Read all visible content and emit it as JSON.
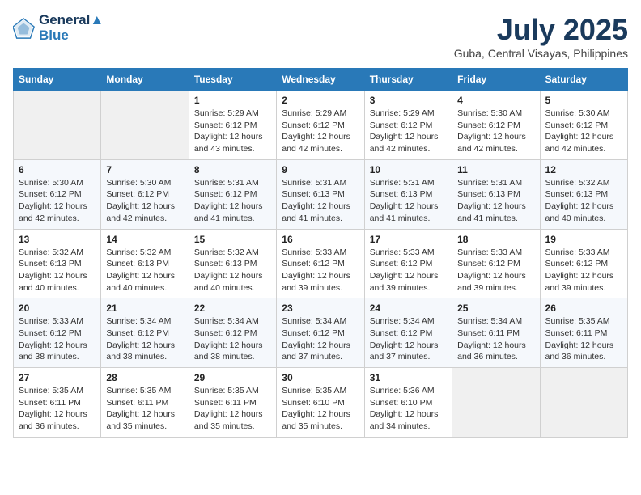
{
  "header": {
    "logo_line1": "General",
    "logo_line2": "Blue",
    "title": "July 2025",
    "subtitle": "Guba, Central Visayas, Philippines"
  },
  "calendar": {
    "days_of_week": [
      "Sunday",
      "Monday",
      "Tuesday",
      "Wednesday",
      "Thursday",
      "Friday",
      "Saturday"
    ],
    "weeks": [
      [
        {
          "num": "",
          "info": ""
        },
        {
          "num": "",
          "info": ""
        },
        {
          "num": "1",
          "info": "Sunrise: 5:29 AM\nSunset: 6:12 PM\nDaylight: 12 hours and 43 minutes."
        },
        {
          "num": "2",
          "info": "Sunrise: 5:29 AM\nSunset: 6:12 PM\nDaylight: 12 hours and 42 minutes."
        },
        {
          "num": "3",
          "info": "Sunrise: 5:29 AM\nSunset: 6:12 PM\nDaylight: 12 hours and 42 minutes."
        },
        {
          "num": "4",
          "info": "Sunrise: 5:30 AM\nSunset: 6:12 PM\nDaylight: 12 hours and 42 minutes."
        },
        {
          "num": "5",
          "info": "Sunrise: 5:30 AM\nSunset: 6:12 PM\nDaylight: 12 hours and 42 minutes."
        }
      ],
      [
        {
          "num": "6",
          "info": "Sunrise: 5:30 AM\nSunset: 6:12 PM\nDaylight: 12 hours and 42 minutes."
        },
        {
          "num": "7",
          "info": "Sunrise: 5:30 AM\nSunset: 6:12 PM\nDaylight: 12 hours and 42 minutes."
        },
        {
          "num": "8",
          "info": "Sunrise: 5:31 AM\nSunset: 6:12 PM\nDaylight: 12 hours and 41 minutes."
        },
        {
          "num": "9",
          "info": "Sunrise: 5:31 AM\nSunset: 6:13 PM\nDaylight: 12 hours and 41 minutes."
        },
        {
          "num": "10",
          "info": "Sunrise: 5:31 AM\nSunset: 6:13 PM\nDaylight: 12 hours and 41 minutes."
        },
        {
          "num": "11",
          "info": "Sunrise: 5:31 AM\nSunset: 6:13 PM\nDaylight: 12 hours and 41 minutes."
        },
        {
          "num": "12",
          "info": "Sunrise: 5:32 AM\nSunset: 6:13 PM\nDaylight: 12 hours and 40 minutes."
        }
      ],
      [
        {
          "num": "13",
          "info": "Sunrise: 5:32 AM\nSunset: 6:13 PM\nDaylight: 12 hours and 40 minutes."
        },
        {
          "num": "14",
          "info": "Sunrise: 5:32 AM\nSunset: 6:13 PM\nDaylight: 12 hours and 40 minutes."
        },
        {
          "num": "15",
          "info": "Sunrise: 5:32 AM\nSunset: 6:13 PM\nDaylight: 12 hours and 40 minutes."
        },
        {
          "num": "16",
          "info": "Sunrise: 5:33 AM\nSunset: 6:12 PM\nDaylight: 12 hours and 39 minutes."
        },
        {
          "num": "17",
          "info": "Sunrise: 5:33 AM\nSunset: 6:12 PM\nDaylight: 12 hours and 39 minutes."
        },
        {
          "num": "18",
          "info": "Sunrise: 5:33 AM\nSunset: 6:12 PM\nDaylight: 12 hours and 39 minutes."
        },
        {
          "num": "19",
          "info": "Sunrise: 5:33 AM\nSunset: 6:12 PM\nDaylight: 12 hours and 39 minutes."
        }
      ],
      [
        {
          "num": "20",
          "info": "Sunrise: 5:33 AM\nSunset: 6:12 PM\nDaylight: 12 hours and 38 minutes."
        },
        {
          "num": "21",
          "info": "Sunrise: 5:34 AM\nSunset: 6:12 PM\nDaylight: 12 hours and 38 minutes."
        },
        {
          "num": "22",
          "info": "Sunrise: 5:34 AM\nSunset: 6:12 PM\nDaylight: 12 hours and 38 minutes."
        },
        {
          "num": "23",
          "info": "Sunrise: 5:34 AM\nSunset: 6:12 PM\nDaylight: 12 hours and 37 minutes."
        },
        {
          "num": "24",
          "info": "Sunrise: 5:34 AM\nSunset: 6:12 PM\nDaylight: 12 hours and 37 minutes."
        },
        {
          "num": "25",
          "info": "Sunrise: 5:34 AM\nSunset: 6:11 PM\nDaylight: 12 hours and 36 minutes."
        },
        {
          "num": "26",
          "info": "Sunrise: 5:35 AM\nSunset: 6:11 PM\nDaylight: 12 hours and 36 minutes."
        }
      ],
      [
        {
          "num": "27",
          "info": "Sunrise: 5:35 AM\nSunset: 6:11 PM\nDaylight: 12 hours and 36 minutes."
        },
        {
          "num": "28",
          "info": "Sunrise: 5:35 AM\nSunset: 6:11 PM\nDaylight: 12 hours and 35 minutes."
        },
        {
          "num": "29",
          "info": "Sunrise: 5:35 AM\nSunset: 6:11 PM\nDaylight: 12 hours and 35 minutes."
        },
        {
          "num": "30",
          "info": "Sunrise: 5:35 AM\nSunset: 6:10 PM\nDaylight: 12 hours and 35 minutes."
        },
        {
          "num": "31",
          "info": "Sunrise: 5:36 AM\nSunset: 6:10 PM\nDaylight: 12 hours and 34 minutes."
        },
        {
          "num": "",
          "info": ""
        },
        {
          "num": "",
          "info": ""
        }
      ]
    ]
  }
}
